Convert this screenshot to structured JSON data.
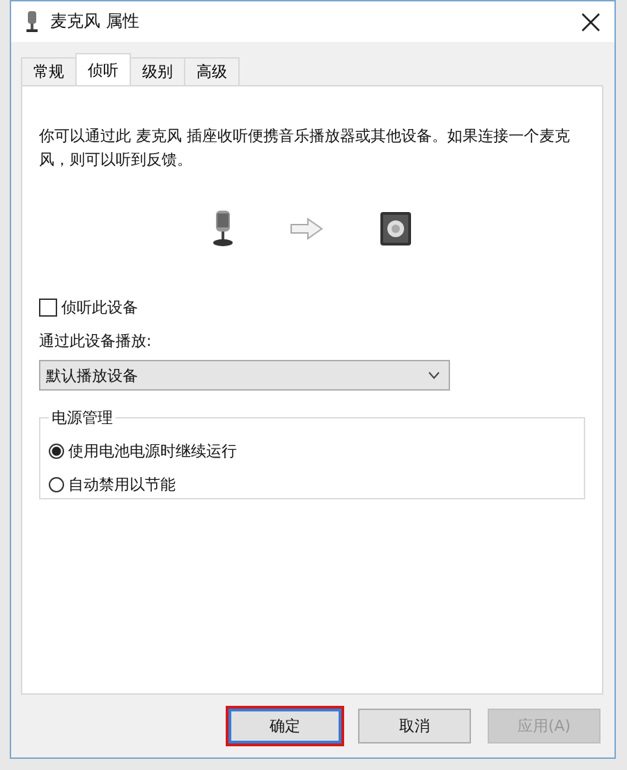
{
  "window": {
    "title": "麦克风 属性"
  },
  "tabs": [
    {
      "label": "常规",
      "selected": false
    },
    {
      "label": "侦听",
      "selected": true
    },
    {
      "label": "级别",
      "selected": false
    },
    {
      "label": "高级",
      "selected": false
    }
  ],
  "description": "你可以通过此 麦克风 插座收听便携音乐播放器或其他设备。如果连接一个麦克风，则可以听到反馈。",
  "listen_checkbox": {
    "label": "侦听此设备",
    "checked": false
  },
  "playback": {
    "label": "通过此设备播放:",
    "value": "默认播放设备"
  },
  "power_group": {
    "title": "电源管理",
    "options": [
      {
        "label": "使用电池电源时继续运行",
        "selected": true
      },
      {
        "label": "自动禁用以节能",
        "selected": false
      }
    ]
  },
  "buttons": [
    {
      "label": "确定",
      "disabled": false,
      "highlighted": true
    },
    {
      "label": "取消",
      "disabled": false,
      "highlighted": false
    },
    {
      "label": "应用(A)",
      "disabled": true,
      "highlighted": false
    }
  ]
}
